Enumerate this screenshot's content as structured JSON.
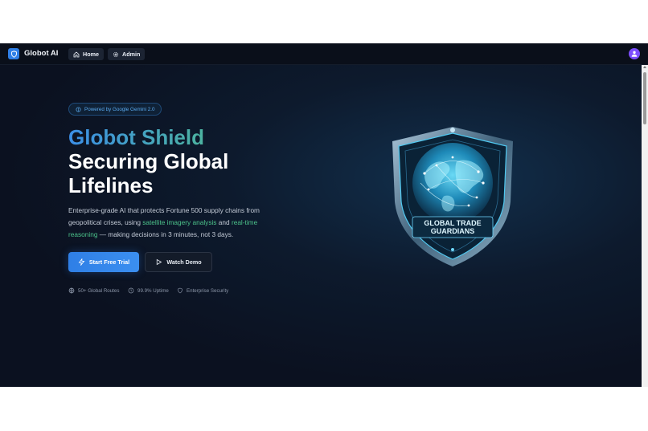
{
  "app": {
    "brand": "Globot AI"
  },
  "nav": {
    "home": "Home",
    "admin": "Admin"
  },
  "hero": {
    "badge": "Powered by Google Gemini 2.0",
    "title_line1": "Globot Shield",
    "title_line2": "Securing Global Lifelines",
    "desc_part1": "Enterprise-grade AI that protects Fortune 500 supply chains from geopolitical crises, using ",
    "desc_hl1": "satellite imagery analysis",
    "desc_part2": " and ",
    "desc_hl2": "real-time reasoning",
    "desc_part3": " — making decisions in 3 minutes, not 3 days.",
    "cta_primary": "Start Free Trial",
    "cta_secondary": "Watch Demo",
    "stats": [
      {
        "label": "50+ Global Routes",
        "icon": "globe-icon"
      },
      {
        "label": "99.9% Uptime",
        "icon": "clock-icon"
      },
      {
        "label": "Enterprise Security",
        "icon": "shield-icon"
      }
    ]
  },
  "emblem": {
    "line1": "GLOBAL TRADE",
    "line2": "GUARDIANS"
  },
  "colors": {
    "accent": "#2f7fe6",
    "highlight": "#4cc28a",
    "background": "#0b1120"
  }
}
